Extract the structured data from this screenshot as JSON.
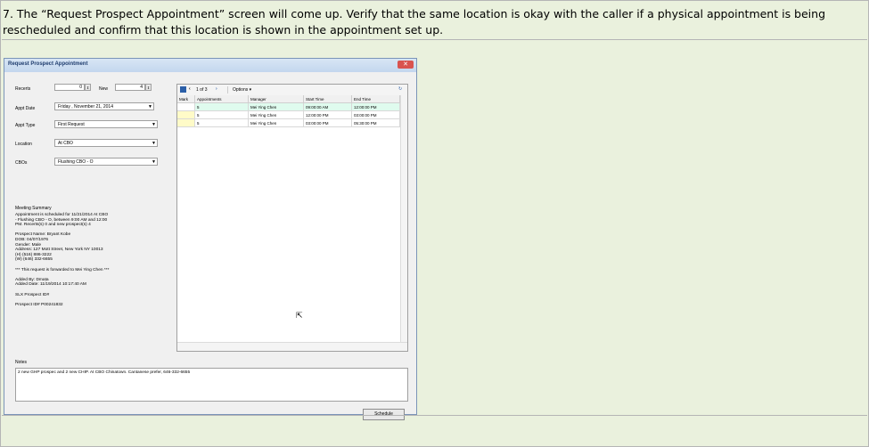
{
  "instruction": {
    "line1": "7. The “Request Prospect Appointment” screen will come up. Verify that the same location is okay with the caller if a physical appointment is being",
    "line2": "rescheduled and confirm that this location is shown in the appointment set up."
  },
  "window": {
    "title": "Request Prospect Appointment",
    "close": "✕"
  },
  "form": {
    "recerts_label": "Recerts",
    "recerts_value": "0",
    "new_label": "New",
    "new_value": "4",
    "appt_date_label": "Appt Date",
    "appt_date_value": "Friday   , November 21, 2014",
    "appt_type_label": "Appt Type",
    "appt_type_value": "First Request",
    "location_label": "Location",
    "location_value": "At CBO",
    "cbos_label": "CBOs",
    "cbos_value": "Flushing CBO - O"
  },
  "grid": {
    "pager": "1 of 3",
    "options": "Options ▾",
    "columns": [
      "Mark",
      "Appointments",
      "Manager",
      "Start Time",
      "End Time"
    ],
    "rows": [
      {
        "appointments": "5",
        "manager": "Mei Ying Chen",
        "start": "09:00:00 AM",
        "end": "12:00:00 PM"
      },
      {
        "appointments": "5",
        "manager": "Mei Ying Chen",
        "start": "12:00:00 PM",
        "end": "03:00:00 PM"
      },
      {
        "appointments": "5",
        "manager": "Mei Ying Chen",
        "start": "03:00:00 PM",
        "end": "05:30:00 PM"
      }
    ]
  },
  "summary": {
    "heading": "Meeting Summary",
    "lines": [
      "Appointment is scheduled for 11/21/2014 At CBO",
      "- Flushing CBO - O, between 9:00 AM and 12:00",
      "PM. Recerts(s) 0 and new prospect(s) 4",
      "",
      "Prospect Name: Bryant Kobe",
      "DOB: 04/07/1976",
      "Gender: Male",
      "Address: 127 Mott Street, New York NY 10013",
      "(H) (516) 886-3222",
      "(W) (646) 332-6655",
      "",
      "*** This request is forwarded to Mei Ying Chen ***",
      "",
      "Added By: Dmata",
      "Added Date: 11/19/2014 10:17:40 AM",
      "",
      "SLX Prospect ID#",
      "",
      "Prospect ID# P00241832"
    ]
  },
  "notes": {
    "label": "Notes",
    "value": "2 new GHP prospec and 2 new CHIP. At CBO Chinatown. Cantanese prefer, 646-332-6655"
  },
  "schedule_label": "Schedule"
}
